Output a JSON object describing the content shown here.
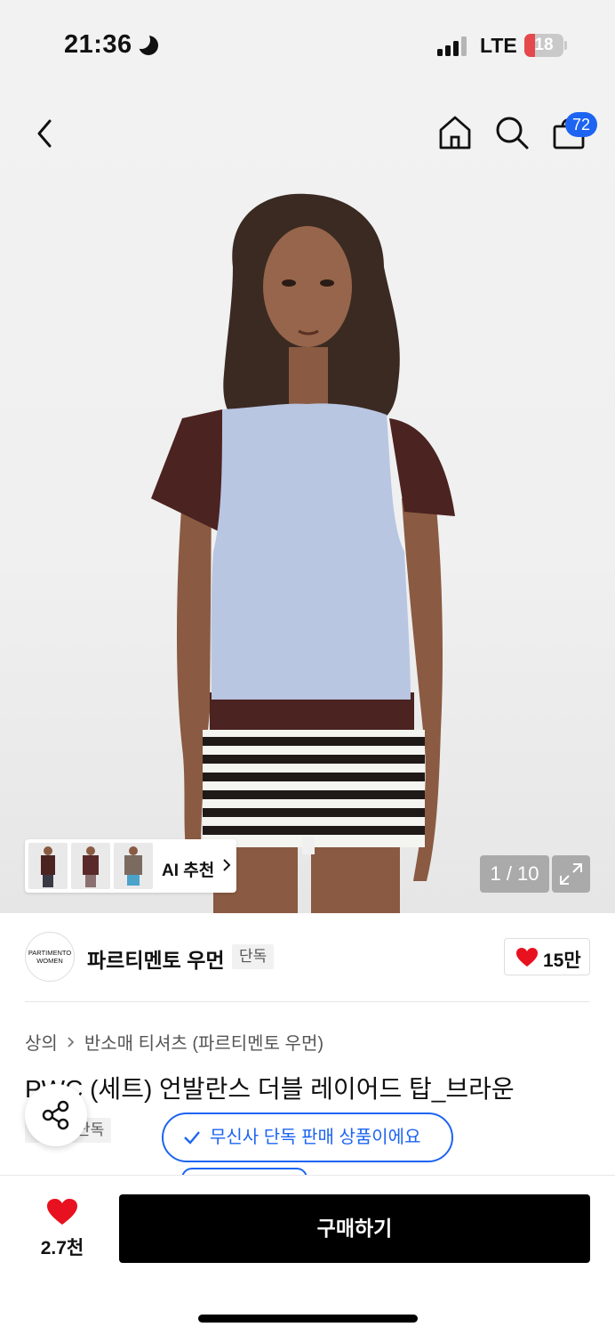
{
  "status_bar": {
    "time": "21:36",
    "network": "LTE",
    "battery": "18"
  },
  "header": {
    "cart_count": "72"
  },
  "gallery": {
    "ai_label": "AI 추천",
    "counter": "1 / 10"
  },
  "brand": {
    "logo_text_line1": "PARTIMENTO",
    "logo_text_line2": "WOMEN",
    "name": "파르티멘토 우먼",
    "exclusive_tag": "단독",
    "likes": "15만"
  },
  "breadcrumb": {
    "level1": "상의",
    "level2": "반소매 티셔츠 (파르티멘토 우먼)"
  },
  "product": {
    "title": "PWC (세트) 언발란스 더블 레이어드 탑_브라운",
    "exclusive_tag": "단독"
  },
  "notice": {
    "text": "무신사 단독 판매 상품이에요"
  },
  "bottom": {
    "wish_count": "2.7천",
    "buy_label": "구매하기"
  },
  "colors": {
    "accent": "#1d64f2",
    "heart": "#e8111f",
    "buy": "#000000"
  }
}
